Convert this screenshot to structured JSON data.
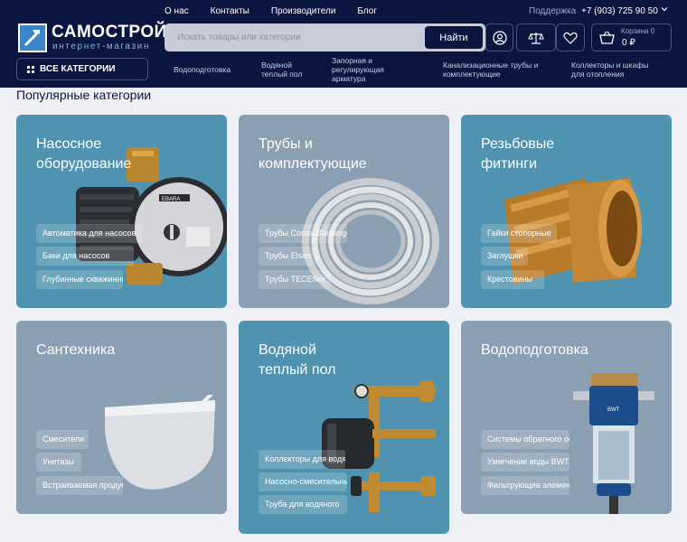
{
  "header": {
    "logo_title": "САМОСТРОЙ",
    "logo_sub": "интернет-магазин",
    "topnav": [
      "О нас",
      "Контакты",
      "Производители",
      "Блог"
    ],
    "support_label": "Поддержка",
    "phone": "+7 (903) 725 90 50",
    "search_placeholder": "Искать товары или категории",
    "search_button": "Найти",
    "cart_label": "Корзина 0",
    "cart_sum": "0 ₽",
    "all_categories": "ВСЕ КАТЕГОРИИ",
    "catnav": [
      "Водоподготовка",
      "Водяной теплый пол",
      "Запорная и регулирующая арматура",
      "Канализационные трубы и комплектующие",
      "Коллекторы и шкафы для отопления"
    ]
  },
  "section_title": "Популярные категории",
  "cards": [
    {
      "title": "Насосное оборудование",
      "subs": [
        "Автоматика для насосов",
        "Баки для насосов",
        "Глубинные скважинные"
      ]
    },
    {
      "title": "Трубы и комплектующие",
      "subs": [
        "Трубы Conex Bänninger",
        "Трубы Elsen",
        "Трубы TECEflex"
      ]
    },
    {
      "title": "Резьбовые фитинги",
      "subs": [
        "Гайки стопорные",
        "Заглушки",
        "Крестовины"
      ]
    },
    {
      "title": "Сантехника",
      "subs": [
        "Смесители",
        "Унитазы",
        "Встраиваемая продукция"
      ]
    },
    {
      "title": "Водяной теплый пол",
      "subs": [
        "Коллекторы для водяного",
        "Насосно-смесительные",
        "Труба для водяного"
      ]
    },
    {
      "title": "Водоподготовка",
      "subs": [
        "Системы обратного осмоса",
        "Умягчение воды BWT",
        "Фильтрующие элементы"
      ]
    }
  ],
  "pump_brand": "EBARA",
  "filter_brand": "BWT",
  "colors": {
    "header_bg": "#0b1640",
    "card_blue": "#4f93b0",
    "card_gray": "#8a9fb2"
  }
}
